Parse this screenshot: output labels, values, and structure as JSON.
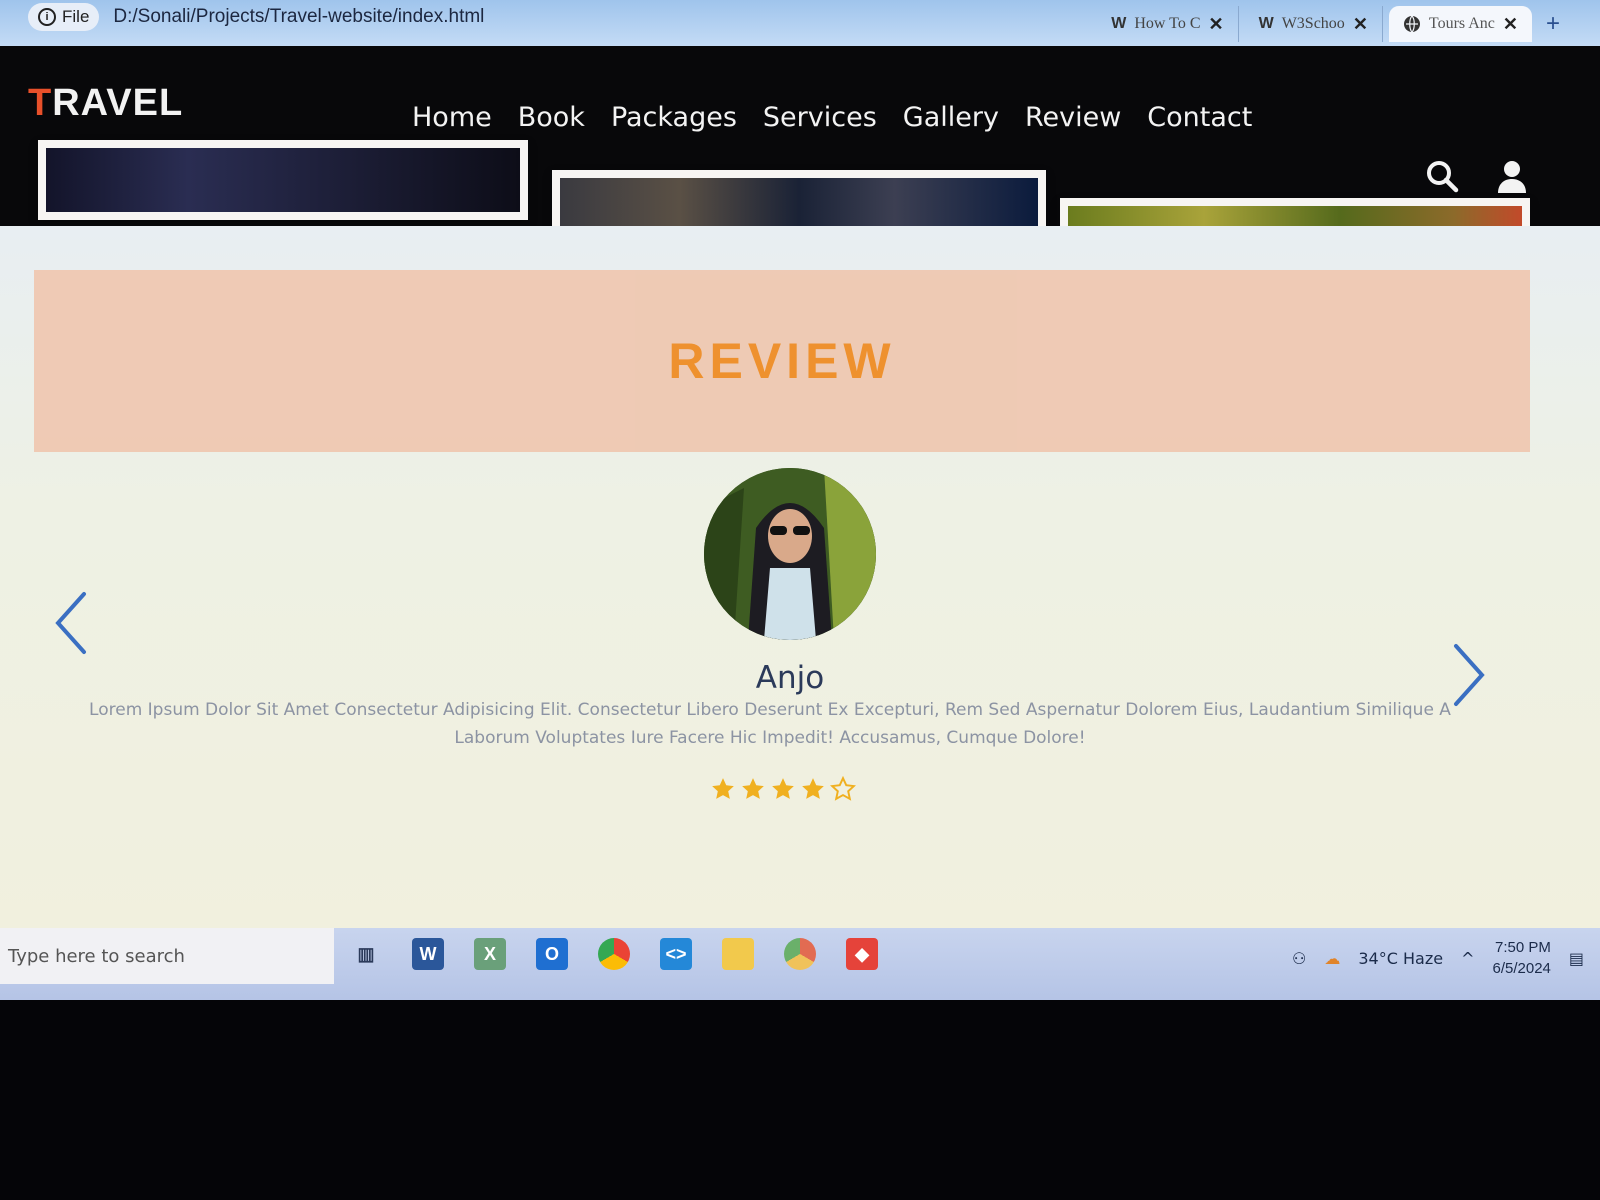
{
  "browser": {
    "file_label": "File",
    "url": "D:/Sonali/Projects/Travel-website/index.html",
    "tabs": [
      {
        "icon": "W",
        "label": "How To C"
      },
      {
        "icon": "W",
        "label": "W3Schoo"
      },
      {
        "icon": "globe",
        "label": "Tours Anc"
      }
    ],
    "new_tab": "+"
  },
  "header": {
    "logo_first": "T",
    "logo_rest": "RAVEL",
    "nav": [
      "Home",
      "Book",
      "Packages",
      "Services",
      "Gallery",
      "Review",
      "Contact"
    ]
  },
  "review": {
    "title": "REVIEW",
    "name": "Anjo",
    "text": "Lorem Ipsum Dolor Sit Amet Consectetur Adipisicing Elit. Consectetur Libero Deserunt Ex Excepturi, Rem Sed Aspernatur Dolorem Eius, Laudantium Similique A Laborum Voluptates Iure Facere Hic Impedit! Accusamus, Cumque Dolore!",
    "rating": 4,
    "rating_max": 5
  },
  "taskbar": {
    "search_placeholder": "Type here to search",
    "apps": [
      "task-view",
      "word",
      "excel",
      "outlook",
      "chrome",
      "vscode",
      "file-explorer",
      "chrome-canary",
      "anydesk"
    ],
    "weather": "34°C  Haze",
    "time": "7:50 PM",
    "date": "6/5/2024"
  },
  "colors": {
    "accent_orange": "#ef8a1f",
    "logo_red": "#e8502a",
    "banner": "#efc7b0",
    "star": "#f0b020"
  }
}
